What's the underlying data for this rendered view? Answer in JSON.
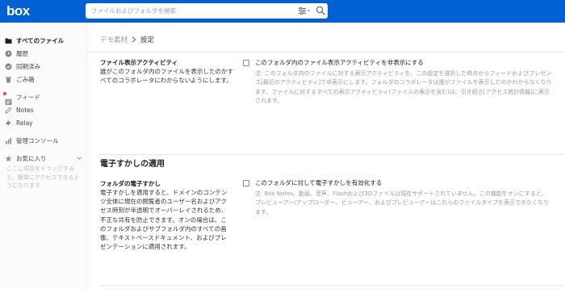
{
  "header": {
    "logo_text": "box",
    "search_placeholder": "ファイルおよびフォルダを検索",
    "filter_icon": "filter-sliders-icon",
    "search_icon": "magnifier-icon",
    "brand_color": "#0061d5"
  },
  "sidebar": {
    "items": [
      {
        "label": "すべてのファイル",
        "icon": "folder-icon",
        "active": true
      },
      {
        "label": "履歴",
        "icon": "clock-icon"
      },
      {
        "label": "同期済み",
        "icon": "check-circle-icon"
      },
      {
        "label": "ごみ箱",
        "icon": "trash-icon"
      },
      {
        "label": "フィード",
        "icon": "feed-icon"
      },
      {
        "label": "Notes",
        "icon": "notes-pencil-icon"
      },
      {
        "label": "Relay",
        "icon": "relay-icon"
      },
      {
        "label": "管理コンソール",
        "icon": "bar-chart-icon"
      },
      {
        "label": "お気に入り",
        "icon": "star-icon"
      }
    ],
    "favorites_hint": "ここに項目をドラッグすると、簡単にアクセスできるようになります"
  },
  "breadcrumb": {
    "parent": "デモ素材",
    "current": "設定"
  },
  "settings": {
    "activity": {
      "title": "ファイル表示アクティビティ",
      "description": "誰がこのフォルダ内のファイルを表示したのかすべてのコラボレータにわからないようにします。",
      "checkbox_label": "このフォルダ内のファイル表示アクティビティを非表示にする",
      "note": "注: このフォルダ内のファイルに対する表示アクティビティを、この設定を選択した時点からフィードおよびプレゼンス[最近のアクティビティ]で非表示にします。フォルダのコラボレータは誰がファイルを表示したのかわからなくなります。ファイルに対するすべての表示アクティビティ(ファイルの表示を含む)は、引き続き[アクセス統計情報]に表示されます。"
    },
    "watermark_section_title": "電子すかしの適用",
    "watermark": {
      "title": "フォルダの電子すかし",
      "description": "電子すかしを適用すると、ドメインのコンテンツ全体に現在の閲覧者のユーザー名およびアクセス時刻が半透明でオーバーレイされるため、不正な共有を防止できます。オンの場合は、このフォルダおよびサブフォルダ内のすべての画像、テキストベースドキュメント、およびプレゼンテーションに適用されます。",
      "checkbox_label": "このフォルダに対して電子すかしを有効化する",
      "note": "注: Box Notes、動画、音声、Flashおよび3Dファイルは現在サポートされていません。この機能をオンにすると、プレビューアー/アップローダー、ビューアー、およびプレビューアーはこれらのファイルタイプを表示できなくなります。"
    }
  }
}
